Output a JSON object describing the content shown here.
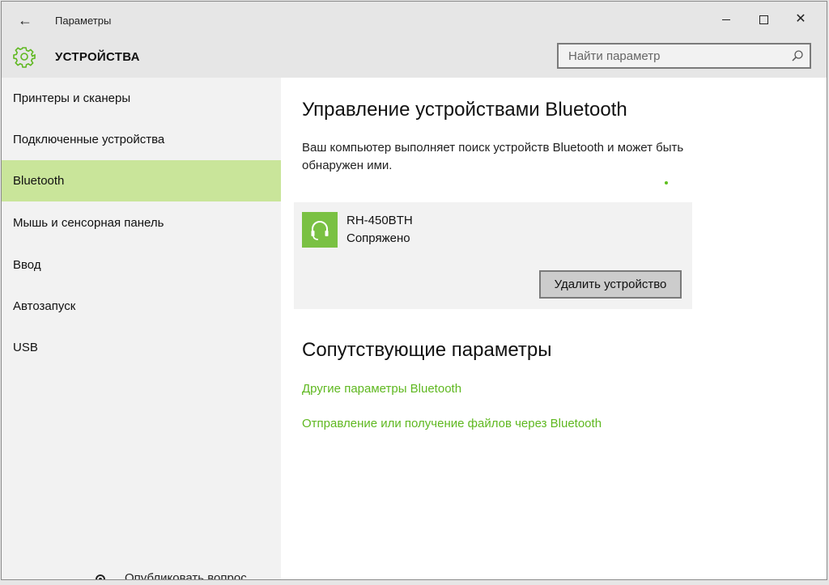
{
  "window": {
    "title": "Параметры",
    "back_icon": "arrow-left-icon",
    "controls": [
      "minimize-icon",
      "maximize-icon",
      "close-icon"
    ]
  },
  "header": {
    "icon": "gear-icon",
    "section_title": "УСТРОЙСТВА",
    "search": {
      "placeholder": "Найти параметр",
      "icon": "search-icon"
    }
  },
  "sidebar": {
    "items": [
      {
        "label": "Принтеры и сканеры",
        "active": false
      },
      {
        "label": "Подключенные устройства",
        "active": false
      },
      {
        "label": "Bluetooth",
        "active": true
      },
      {
        "label": "Мышь и сенсорная панель",
        "active": false
      },
      {
        "label": "Ввод",
        "active": false
      },
      {
        "label": "Автозапуск",
        "active": false
      },
      {
        "label": "USB",
        "active": false
      }
    ],
    "active_color": "#c9e59a"
  },
  "background": {
    "partial_text": "Опубликовать вопрос"
  },
  "main": {
    "title": "Управление устройствами Bluetooth",
    "description": "Ваш компьютер выполняет поиск устройств Bluetooth и может быть обнаружен ими.",
    "device": {
      "icon": "headset-icon",
      "name": "RH-450BTH",
      "status": "Сопряжено",
      "remove_label": "Удалить устройство"
    },
    "related_title": "Сопутствующие параметры",
    "links": [
      "Другие параметры Bluetooth",
      "Отправление или получение файлов через Bluetooth"
    ],
    "accent_color": "#5fb820"
  }
}
